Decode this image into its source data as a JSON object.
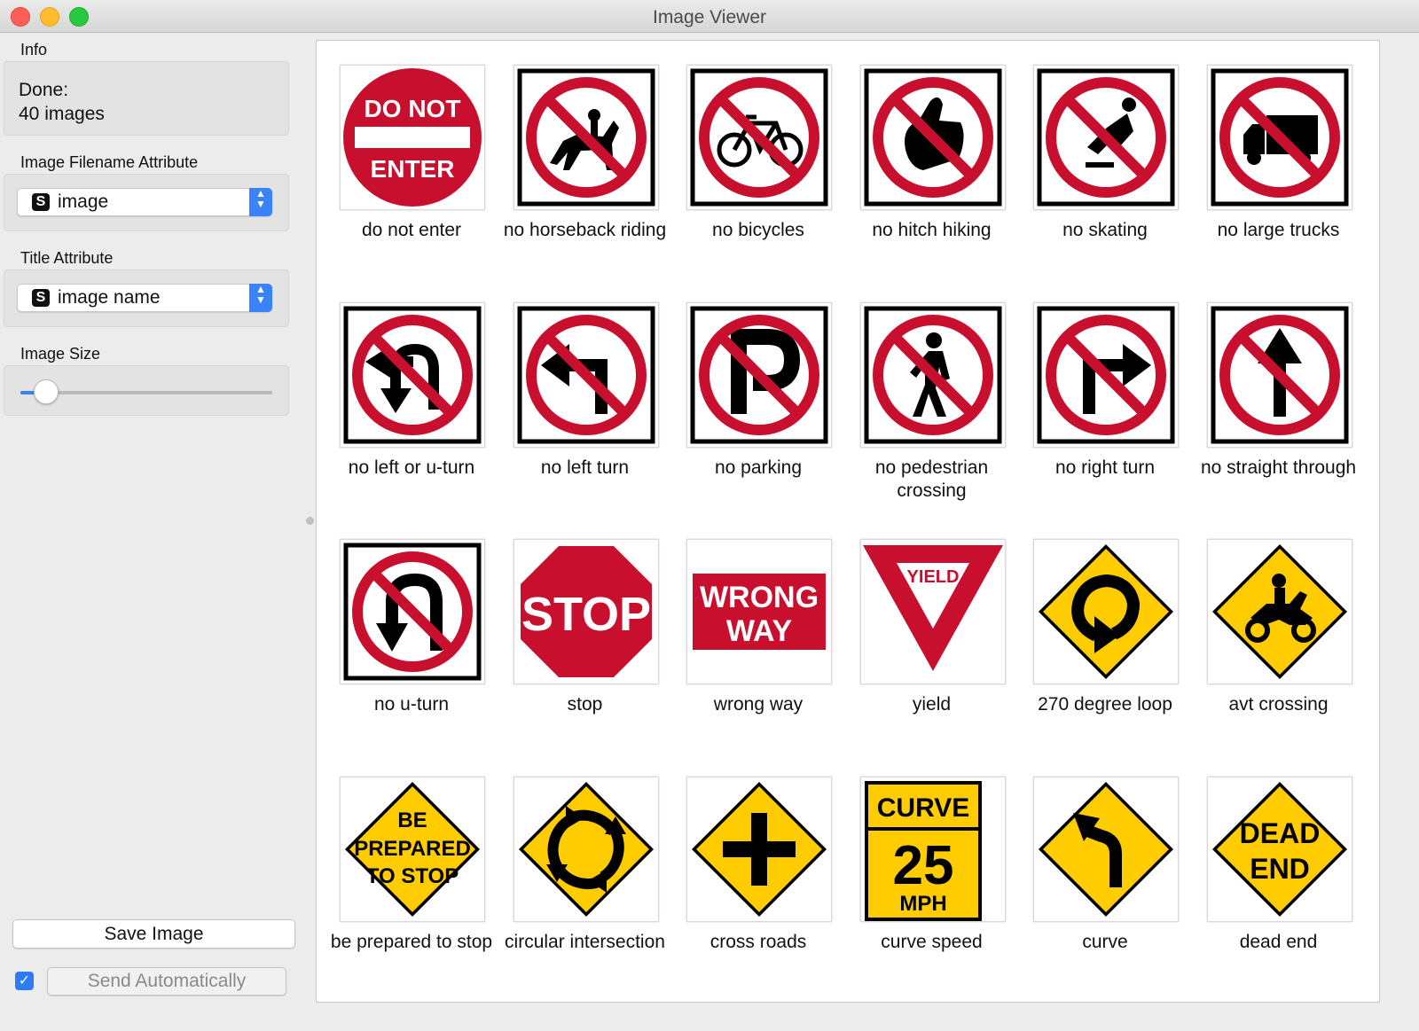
{
  "window": {
    "title": "Image Viewer"
  },
  "info": {
    "label": "Info",
    "status": "Done:",
    "count": "40 images"
  },
  "filename_attr": {
    "label": "Image Filename Attribute",
    "value": "image"
  },
  "title_attr": {
    "label": "Title Attribute",
    "value": "image name"
  },
  "image_size": {
    "label": "Image Size",
    "level": 0.1
  },
  "buttons": {
    "save": "Save Image",
    "send": "Send Automatically",
    "send_checked": true
  },
  "colors": {
    "red": "#c8102e",
    "yellow": "#ffcc00",
    "accent": "#3a82f7"
  },
  "images": [
    {
      "title": "do not enter",
      "icon": "do-not-enter-sign",
      "text": [
        "DO NOT",
        "ENTER"
      ]
    },
    {
      "title": "no horseback riding",
      "icon": "no-horseback-riding-sign"
    },
    {
      "title": "no bicycles",
      "icon": "no-bicycles-sign"
    },
    {
      "title": "no hitch hiking",
      "icon": "no-hitch-hiking-sign"
    },
    {
      "title": "no skating",
      "icon": "no-skating-sign"
    },
    {
      "title": "no large trucks",
      "icon": "no-large-trucks-sign"
    },
    {
      "title": "no left or u-turn",
      "icon": "no-left-or-u-turn-sign"
    },
    {
      "title": "no left turn",
      "icon": "no-left-turn-sign"
    },
    {
      "title": "no parking",
      "icon": "no-parking-sign"
    },
    {
      "title": "no pedestrian crossing",
      "icon": "no-pedestrian-crossing-sign"
    },
    {
      "title": "no right turn",
      "icon": "no-right-turn-sign"
    },
    {
      "title": "no straight through",
      "icon": "no-straight-through-sign"
    },
    {
      "title": "no u-turn",
      "icon": "no-u-turn-sign"
    },
    {
      "title": "stop",
      "icon": "stop-sign",
      "text": [
        "STOP"
      ]
    },
    {
      "title": "wrong way",
      "icon": "wrong-way-sign",
      "text": [
        "WRONG",
        "WAY"
      ]
    },
    {
      "title": "yield",
      "icon": "yield-sign",
      "text": [
        "YIELD"
      ]
    },
    {
      "title": "270 degree loop",
      "icon": "270-degree-loop-sign"
    },
    {
      "title": "avt crossing",
      "icon": "avt-crossing-sign"
    },
    {
      "title": "be prepared to stop",
      "icon": "be-prepared-to-stop-sign",
      "text": [
        "BE",
        "PREPARED",
        "TO STOP"
      ]
    },
    {
      "title": "circular intersection",
      "icon": "circular-intersection-sign"
    },
    {
      "title": "cross roads",
      "icon": "cross-roads-sign"
    },
    {
      "title": "curve speed",
      "icon": "curve-speed-sign",
      "text": [
        "CURVE",
        "25",
        "MPH"
      ]
    },
    {
      "title": "curve",
      "icon": "curve-sign"
    },
    {
      "title": "dead end",
      "icon": "dead-end-sign",
      "text": [
        "DEAD",
        "END"
      ]
    }
  ]
}
